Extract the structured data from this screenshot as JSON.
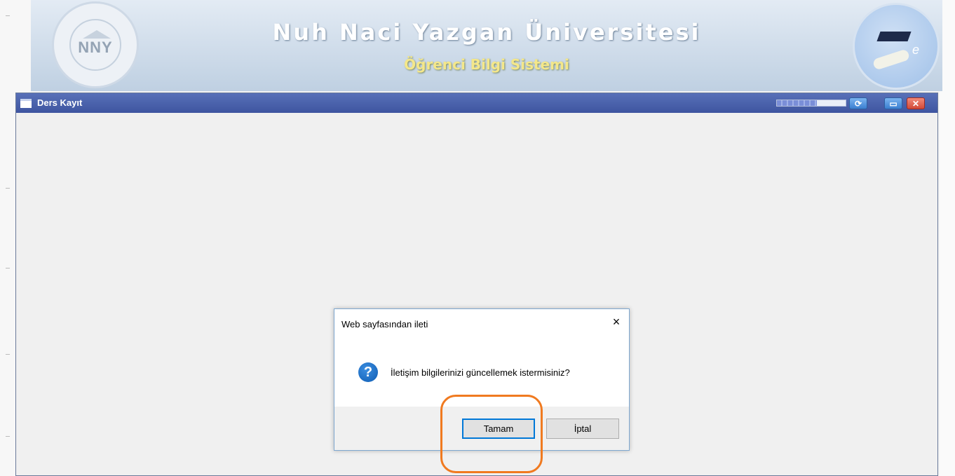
{
  "header": {
    "logo_text": "NNY",
    "title": "Nuh Naci Yazgan Üniversitesi",
    "subtitle": "Öğrenci Bilgi Sistemi"
  },
  "window": {
    "title": "Ders Kayıt",
    "controls": {
      "refresh_icon": "refresh-icon",
      "maximize_icon": "maximize-icon",
      "close_icon": "close-icon"
    }
  },
  "dialog": {
    "title": "Web sayfasından ileti",
    "close_label": "×",
    "message": "İletişim bilgilerinizi güncellemek istermisiniz?",
    "icon": "?",
    "ok_label": "Tamam",
    "cancel_label": "İptal"
  },
  "colors": {
    "titlebar": "#4a63ac",
    "highlight": "#f07a20",
    "subtitle": "#f4e78a"
  }
}
